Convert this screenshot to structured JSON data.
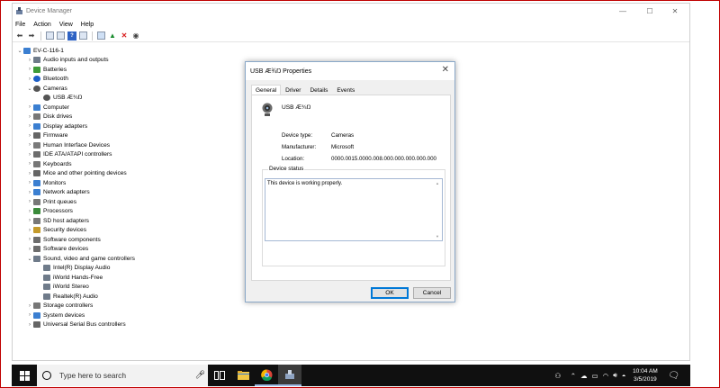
{
  "window": {
    "title": "Device Manager",
    "controls": {
      "minimize": "—",
      "maximize": "☐",
      "close": "✕"
    }
  },
  "menu": [
    "File",
    "Action",
    "View",
    "Help"
  ],
  "tree": {
    "root": "EV-C-116-1",
    "items": [
      {
        "label": "Audio inputs and outputs",
        "indent": 1,
        "expand": "collapsed",
        "icon": "speaker",
        "color": "#6f7b8a"
      },
      {
        "label": "Batteries",
        "indent": 1,
        "expand": "collapsed",
        "icon": "battery",
        "color": "#3f9b3a"
      },
      {
        "label": "Bluetooth",
        "indent": 1,
        "expand": "collapsed",
        "icon": "bluetooth",
        "color": "#1d5fc7"
      },
      {
        "label": "Cameras",
        "indent": 1,
        "expand": "expanded",
        "icon": "camera",
        "color": "#555555"
      },
      {
        "label": "USB Æ¾Ŋ",
        "indent": 2,
        "expand": "none",
        "icon": "camera",
        "color": "#555555"
      },
      {
        "label": "Computer",
        "indent": 1,
        "expand": "collapsed",
        "icon": "monitor",
        "color": "#3b7fd1"
      },
      {
        "label": "Disk drives",
        "indent": 1,
        "expand": "collapsed",
        "icon": "disk",
        "color": "#777777"
      },
      {
        "label": "Display adapters",
        "indent": 1,
        "expand": "collapsed",
        "icon": "monitor",
        "color": "#3b7fd1"
      },
      {
        "label": "Firmware",
        "indent": 1,
        "expand": "collapsed",
        "icon": "chip",
        "color": "#666666"
      },
      {
        "label": "Human Interface Devices",
        "indent": 1,
        "expand": "collapsed",
        "icon": "hid",
        "color": "#7a7a7a"
      },
      {
        "label": "IDE ATA/ATAPI controllers",
        "indent": 1,
        "expand": "collapsed",
        "icon": "controller",
        "color": "#6d6d6d"
      },
      {
        "label": "Keyboards",
        "indent": 1,
        "expand": "collapsed",
        "icon": "keyboard",
        "color": "#777777"
      },
      {
        "label": "Mice and other pointing devices",
        "indent": 1,
        "expand": "collapsed",
        "icon": "mouse",
        "color": "#666666"
      },
      {
        "label": "Monitors",
        "indent": 1,
        "expand": "collapsed",
        "icon": "monitor",
        "color": "#3b7fd1"
      },
      {
        "label": "Network adapters",
        "indent": 1,
        "expand": "collapsed",
        "icon": "network",
        "color": "#3b7fd1"
      },
      {
        "label": "Print queues",
        "indent": 1,
        "expand": "collapsed",
        "icon": "printer",
        "color": "#777777"
      },
      {
        "label": "Processors",
        "indent": 1,
        "expand": "collapsed",
        "icon": "cpu",
        "color": "#3a8a3a"
      },
      {
        "label": "SD host adapters",
        "indent": 1,
        "expand": "collapsed",
        "icon": "sd",
        "color": "#777777"
      },
      {
        "label": "Security devices",
        "indent": 1,
        "expand": "collapsed",
        "icon": "security",
        "color": "#c49a2b"
      },
      {
        "label": "Software components",
        "indent": 1,
        "expand": "collapsed",
        "icon": "component",
        "color": "#6d6d6d"
      },
      {
        "label": "Software devices",
        "indent": 1,
        "expand": "collapsed",
        "icon": "device",
        "color": "#6d6d6d"
      },
      {
        "label": "Sound, video and game controllers",
        "indent": 1,
        "expand": "expanded",
        "icon": "speaker",
        "color": "#6f7b8a"
      },
      {
        "label": "Intel(R) Display Audio",
        "indent": 2,
        "expand": "none",
        "icon": "speaker",
        "color": "#6f7b8a"
      },
      {
        "label": "iWorld Hands-Free",
        "indent": 2,
        "expand": "none",
        "icon": "speaker",
        "color": "#6f7b8a"
      },
      {
        "label": "iWorld Stereo",
        "indent": 2,
        "expand": "none",
        "icon": "speaker",
        "color": "#6f7b8a"
      },
      {
        "label": "Realtek(R) Audio",
        "indent": 2,
        "expand": "none",
        "icon": "speaker",
        "color": "#6f7b8a"
      },
      {
        "label": "Storage controllers",
        "indent": 1,
        "expand": "collapsed",
        "icon": "storage",
        "color": "#777777"
      },
      {
        "label": "System devices",
        "indent": 1,
        "expand": "collapsed",
        "icon": "monitor",
        "color": "#3b7fd1"
      },
      {
        "label": "Universal Serial Bus controllers",
        "indent": 1,
        "expand": "collapsed",
        "icon": "usb",
        "color": "#666666"
      }
    ]
  },
  "dialog": {
    "title": "USB Æ¾Ŋ Properties",
    "close": "✕",
    "tabs": [
      "General",
      "Driver",
      "Details",
      "Events"
    ],
    "active_tab": "General",
    "device_name": "USB Æ¾Ŋ",
    "properties": [
      {
        "label": "Device type:",
        "value": "Cameras"
      },
      {
        "label": "Manufacturer:",
        "value": "Microsoft"
      },
      {
        "label": "Location:",
        "value": "0000.0015.0000.008.000.000.000.000.000"
      }
    ],
    "status_label": "Device status",
    "status_text": "This device is working properly.",
    "ok": "OK",
    "cancel": "Cancel"
  },
  "taskbar": {
    "search_placeholder": "Type here to search",
    "time": "10:04 AM",
    "date": "3/5/2019"
  },
  "colors": {
    "border": "#c00000",
    "taskbar": "#101010",
    "accent": "#0078d7"
  }
}
